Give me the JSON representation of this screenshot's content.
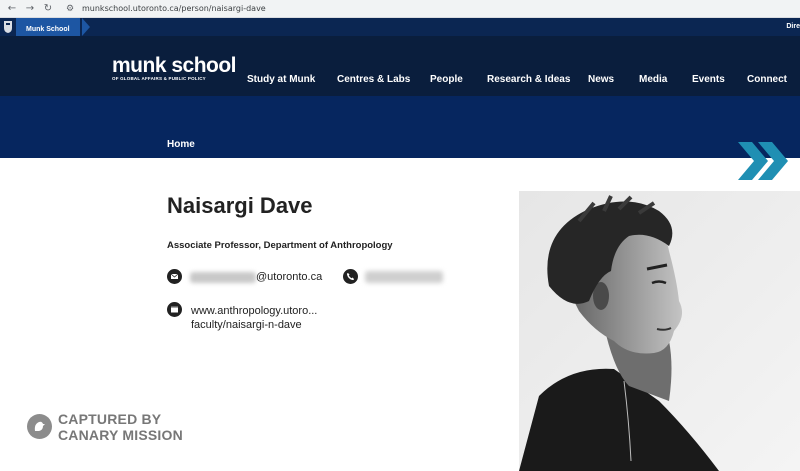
{
  "browser": {
    "back_icon": "arrow-left-icon",
    "forward_icon": "arrow-right-icon",
    "reload_icon": "reload-icon",
    "url": "munkschool.utoronto.ca/person/naisargi-dave"
  },
  "utility_bar": {
    "crumb": "Munk School",
    "right_text": "Dire"
  },
  "header": {
    "logo_main": "munk school",
    "logo_sub": "OF GLOBAL AFFAIRS & PUBLIC POLICY",
    "nav": [
      "Study at Munk",
      "Centres & Labs",
      "People",
      "Research & Ideas",
      "News",
      "Media",
      "Events",
      "Connect"
    ]
  },
  "banner": {
    "home": "Home"
  },
  "profile": {
    "name": "Naisargi Dave",
    "title": "Associate Professor, Department of Anthropology",
    "email_domain": "@utoronto.ca",
    "website_line1": "www.anthropology.utoro...",
    "website_line2": "faculty/naisargi-n-dave",
    "email_icon": "email-icon",
    "phone_icon": "phone-icon",
    "web_icon": "web-icon"
  },
  "watermark": {
    "line1": "CAPTURED BY",
    "line2": "CANARY MISSION"
  },
  "colors": {
    "utility_bar": "#0b2652",
    "header": "#0a1e3d",
    "banner": "#06265f",
    "crumb": "#1d56a3",
    "chevron": "#1f8fb3"
  }
}
